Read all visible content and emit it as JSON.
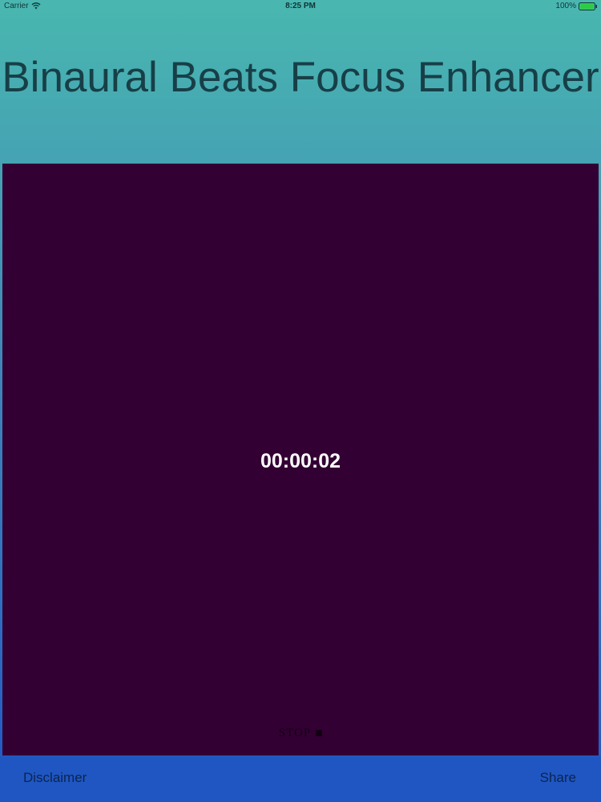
{
  "status_bar": {
    "carrier": "Carrier",
    "time": "8:25 PM",
    "battery": "100%",
    "icons": [
      "wifi-icon",
      "battery-icon"
    ]
  },
  "header": {
    "title": "Binaural Beats Focus Enhancer"
  },
  "player": {
    "timer": "00:00:02",
    "stop_label": "STOP",
    "panel_color": "#330033"
  },
  "footer": {
    "disclaimer_label": "Disclaimer",
    "share_label": "Share"
  }
}
